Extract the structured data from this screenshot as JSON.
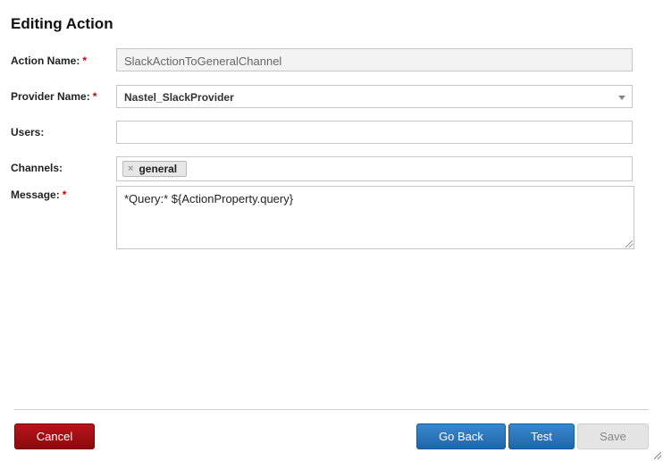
{
  "dialog": {
    "title": "Editing Action"
  },
  "form": {
    "required_mark": "*",
    "action_name": {
      "label": "Action Name:",
      "value": "SlackActionToGeneralChannel"
    },
    "provider_name": {
      "label": "Provider Name:",
      "value": "Nastel_SlackProvider"
    },
    "users": {
      "label": "Users:",
      "value": ""
    },
    "channels": {
      "label": "Channels:",
      "tags": [
        "general"
      ],
      "remove_glyph": "×"
    },
    "message": {
      "label": "Message:",
      "value": "*Query:* ${ActionProperty.query}"
    }
  },
  "footer": {
    "cancel_label": "Cancel",
    "goback_label": "Go Back",
    "test_label": "Test",
    "save_label": "Save"
  },
  "colors": {
    "cancel": "#a00f14",
    "primary": "#2a74b8",
    "required": "#cc0000"
  }
}
